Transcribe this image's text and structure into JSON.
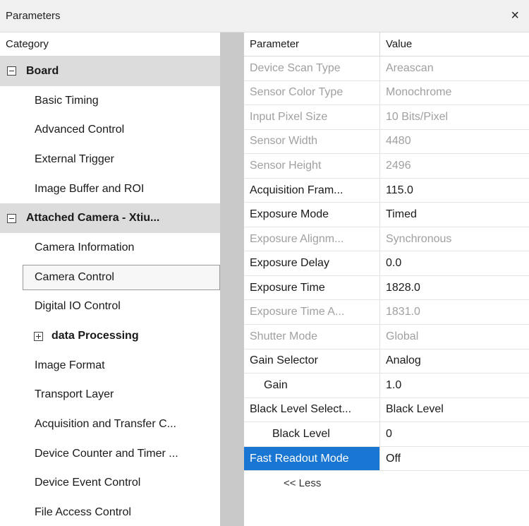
{
  "window": {
    "title": "Parameters",
    "close_glyph": "×"
  },
  "category_panel": {
    "header": "Category",
    "items": [
      {
        "label": "Board",
        "type": "group",
        "expander": "minus"
      },
      {
        "label": "Basic Timing"
      },
      {
        "label": "Advanced Control"
      },
      {
        "label": "External Trigger"
      },
      {
        "label": "Image Buffer and ROI"
      },
      {
        "label": "Attached Camera - Xtiu...",
        "type": "group",
        "expander": "minus"
      },
      {
        "label": "Camera Information"
      },
      {
        "label": "Camera Control",
        "selected": true
      },
      {
        "label": "Digital IO Control"
      },
      {
        "label": "data Processing",
        "type": "sub",
        "expander": "plus"
      },
      {
        "label": "Image Format"
      },
      {
        "label": "Transport Layer"
      },
      {
        "label": "Acquisition and Transfer C..."
      },
      {
        "label": "Device Counter and Timer ..."
      },
      {
        "label": "Device Event Control"
      },
      {
        "label": "File Access Control"
      }
    ]
  },
  "parameter_grid": {
    "header_parameter": "Parameter",
    "header_value": "Value",
    "rows": [
      {
        "name": "Device Scan Type",
        "value": "Areascan",
        "readonly": true
      },
      {
        "name": "Sensor Color Type",
        "value": "Monochrome",
        "readonly": true
      },
      {
        "name": "Input Pixel Size",
        "value": "10 Bits/Pixel",
        "readonly": true
      },
      {
        "name": "Sensor Width",
        "value": "4480",
        "readonly": true
      },
      {
        "name": "Sensor Height",
        "value": "2496",
        "readonly": true
      },
      {
        "name": "Acquisition Fram...",
        "value": "115.0"
      },
      {
        "name": "Exposure Mode",
        "value": "Timed"
      },
      {
        "name": "Exposure Alignm...",
        "value": "Synchronous",
        "readonly": true
      },
      {
        "name": "Exposure Delay",
        "value": "0.0"
      },
      {
        "name": "Exposure Time",
        "value": "1828.0"
      },
      {
        "name": "Exposure Time A...",
        "value": "1831.0",
        "readonly": true
      },
      {
        "name": "Shutter Mode",
        "value": "Global",
        "readonly": true
      },
      {
        "name": "Gain Selector",
        "value": "Analog"
      },
      {
        "name": "Gain",
        "value": "1.0",
        "indent": 1
      },
      {
        "name": "Black Level Select...",
        "value": "Black Level"
      },
      {
        "name": "Black Level",
        "value": "0",
        "indent": 2
      },
      {
        "name": "Fast Readout Mode",
        "value": "Off",
        "selected": true
      }
    ],
    "less_label": "<< Less"
  },
  "colors": {
    "selection": "#1976d2",
    "group_bg": "#dcdcdc",
    "gutter": "#c9c9c9"
  }
}
